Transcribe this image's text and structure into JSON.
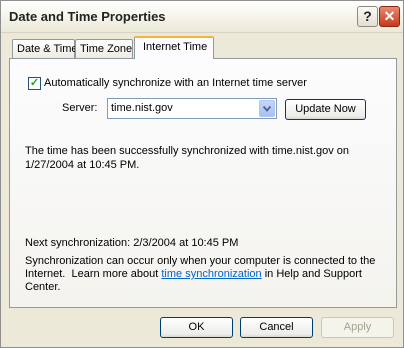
{
  "window": {
    "title": "Date and Time Properties",
    "help_label": "?",
    "close_label": "✕"
  },
  "tabs": [
    {
      "label": "Date & Time",
      "active": false
    },
    {
      "label": "Time Zone",
      "active": false
    },
    {
      "label": "Internet Time",
      "active": true
    }
  ],
  "sync": {
    "checkbox_label": "Automatically synchronize with an Internet time server",
    "checked": true,
    "server_label": "Server:",
    "server_value": "time.nist.gov",
    "update_button": "Update Now",
    "status_line1": "The time has been successfully synchronized with time.nist.gov on",
    "status_line2": "1/27/2004 at 10:45 PM.",
    "next_sync": "Next synchronization: 2/3/2004 at 10:45 PM",
    "info_line1": "Synchronization can occur only when your computer is connected to the",
    "info_line2_pre": "Internet.  Learn more about ",
    "info_link": "time synchronization",
    "info_line2_post": " in Help and Support",
    "info_line3": "Center."
  },
  "footer": {
    "ok": "OK",
    "cancel": "Cancel",
    "apply": "Apply"
  },
  "colors": {
    "tab_highlight": "#f6b43a",
    "close_button": "#c73a1c",
    "link": "#0066cc"
  }
}
